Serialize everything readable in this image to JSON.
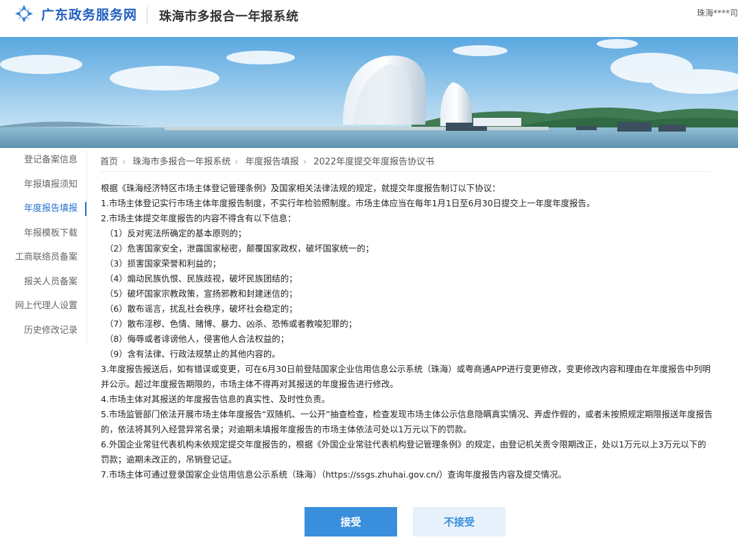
{
  "header": {
    "brand": "广东政务服务网",
    "system_title": "珠海市多报合一年报系统",
    "user": "珠海****司"
  },
  "sidebar": {
    "items": [
      {
        "label": "登记备案信息"
      },
      {
        "label": "年报填报须知"
      },
      {
        "label": "年度报告填报",
        "active": true
      },
      {
        "label": "年报模板下载"
      },
      {
        "label": "工商联络员备案"
      },
      {
        "label": "报关人员备案"
      },
      {
        "label": "网上代理人设置"
      },
      {
        "label": "历史修改记录"
      }
    ]
  },
  "breadcrumb": [
    "首页",
    "珠海市多报合一年报系统",
    "年度报告填报",
    "2022年度提交年度报告协议书"
  ],
  "agreement": {
    "intro": "根据《珠海经济特区市场主体登记管理条例》及国家相关法律法规的规定，就提交年度报告制订以下协议：",
    "item1": "1.市场主体登记实行市场主体年度报告制度，不实行年检验照制度。市场主体应当在每年1月1日至6月30日提交上一年度年度报告。",
    "item2": "2.市场主体提交年度报告的内容不得含有以下信息：",
    "sub": [
      "（1）反对宪法所确定的基本原则的；",
      "（2）危害国家安全，泄露国家秘密，颠覆国家政权，破坏国家统一的；",
      "（3）损害国家荣誉和利益的；",
      "（4）煽动民族仇恨、民族歧视，破坏民族团结的；",
      "（5）破坏国家宗教政策，宣扬邪教和封建迷信的；",
      "（6）散布谣言，扰乱社会秩序，破坏社会稳定的；",
      "（7）散布淫秽、色情、赌博、暴力、凶杀、恐怖或者教唆犯罪的；",
      "（8）侮辱或者诽谤他人，侵害他人合法权益的；",
      "（9）含有法律、行政法规禁止的其他内容的。"
    ],
    "item3": "3.年度报告报送后，如有错误或变更，可在6月30日前登陆国家企业信用信息公示系统（珠海）或粤商通APP进行变更修改，变更修改内容和理由在年度报告中列明并公示。超过年度报告期限的，市场主体不得再对其报送的年度报告进行修改。",
    "item4": "4.市场主体对其报送的年度报告信息的真实性、及时性负责。",
    "item5": "5.市场监管部门依法开展市场主体年度报告“双随机、一公开”抽查检查，检查发现市场主体公示信息隐瞒真实情况、弄虚作假的，或者未按照规定期限报送年度报告的，依法将其列入经营异常名录；对逾期未填报年度报告的市场主体依法可处以1万元以下的罚款。",
    "item6": "6.外国企业常驻代表机构未依规定提交年度报告的，根据《外国企业常驻代表机构登记管理条例》的规定，由登记机关责令限期改正，处以1万元以上3万元以下的罚款；逾期未改正的，吊销登记证。",
    "item7": "7.市场主体可通过登录国家企业信用信息公示系统（珠海）（https://ssgs.zhuhai.gov.cn/）查询年度报告内容及提交情况。"
  },
  "buttons": {
    "accept": "接受",
    "reject": "不接受"
  },
  "colors": {
    "accent": "#3a8fdc",
    "brand": "#1f5fbf"
  }
}
